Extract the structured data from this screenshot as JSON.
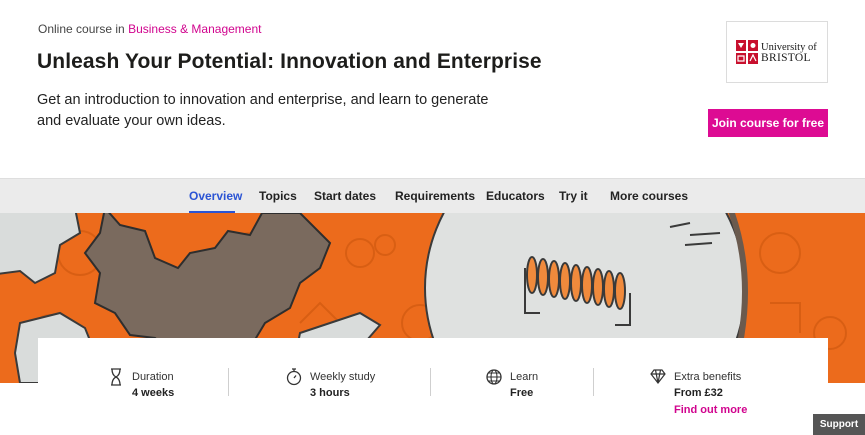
{
  "header": {
    "crumb_prefix": "Online course in",
    "crumb_link": "Business & Management",
    "title": "Unleash Your Potential: Innovation and Enterprise",
    "description": "Get an introduction to innovation and enterprise, and learn to generate and evaluate your own ideas.",
    "join_label": "Join course for free",
    "logo_line1": "University of",
    "logo_line2": "BRISTOL"
  },
  "tabs": [
    {
      "label": "Overview",
      "active": true
    },
    {
      "label": "Topics"
    },
    {
      "label": "Start dates"
    },
    {
      "label": "Requirements"
    },
    {
      "label": "Educators"
    },
    {
      "label": "Try it"
    },
    {
      "label": "More courses"
    }
  ],
  "stats": [
    {
      "label": "Duration",
      "value": "4 weeks",
      "icon": "hourglass-icon"
    },
    {
      "label": "Weekly study",
      "value": "3 hours",
      "icon": "stopwatch-icon"
    },
    {
      "label": "Learn",
      "value": "Free",
      "icon": "globe-icon"
    },
    {
      "label": "Extra benefits",
      "value": "From £32",
      "link": "Find out more",
      "icon": "diamond-icon"
    }
  ],
  "support_label": "Support",
  "colors": {
    "brand_pink": "#dd0b93",
    "tab_active": "#2b54d4",
    "hero_orange": "#ec6b1c"
  }
}
